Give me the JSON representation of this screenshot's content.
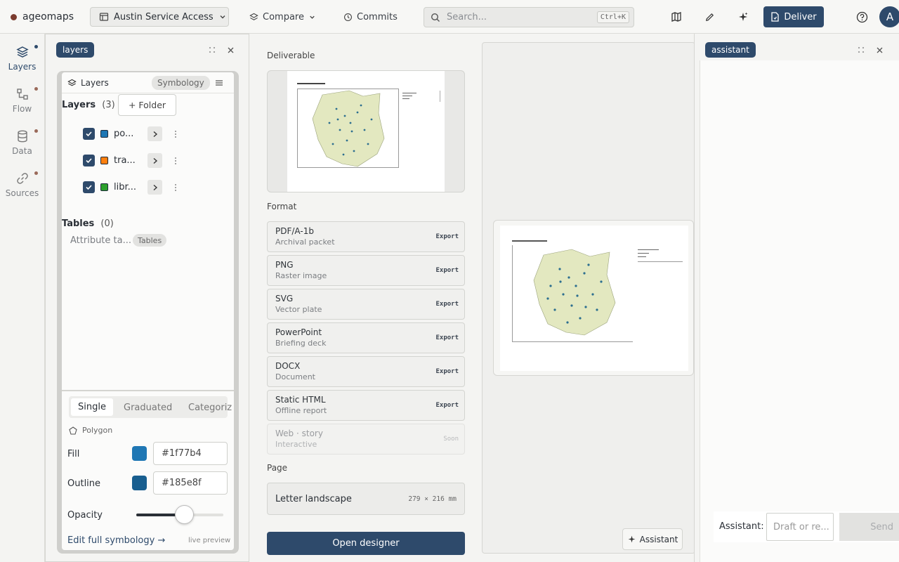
{
  "app": {
    "name": "ageomaps"
  },
  "topbar": {
    "project": "Austin Service Access",
    "compare": "Compare",
    "commits": "Commits",
    "search_placeholder": "Search...",
    "search_shortcut": "Ctrl+K",
    "deliver": "Deliver",
    "avatar": "A"
  },
  "rail": {
    "items": [
      {
        "label": "Layers",
        "icon": "layers-icon"
      },
      {
        "label": "Flow",
        "icon": "flow-icon"
      },
      {
        "label": "Data",
        "icon": "database-icon"
      },
      {
        "label": "Sources",
        "icon": "link-icon"
      }
    ]
  },
  "layers_panel": {
    "tab": "layers",
    "header_title": "Layers",
    "symbology_tab": "Symbology",
    "layers_heading": "Layers",
    "layers_count": "(3)",
    "folder_button": "+ Folder",
    "layers": [
      {
        "name": "po...",
        "color": "#1f77b4",
        "checked": true
      },
      {
        "name": "tra...",
        "color": "#ff7f0e",
        "checked": true
      },
      {
        "name": "libr...",
        "color": "#2ca02c",
        "checked": true
      }
    ],
    "tables_heading": "Tables",
    "tables_count": "(0)",
    "attribute_table": "Attribute ta...",
    "tables_badge": "Tables",
    "symbology": {
      "modes": [
        "Single",
        "Graduated",
        "Categorize"
      ],
      "active_mode": "Single",
      "geometry": "Polygon",
      "fill_label": "Fill",
      "fill_value": "#1f77b4",
      "outline_label": "Outline",
      "outline_value": "#185e8f",
      "opacity_label": "Opacity",
      "opacity": 0.55,
      "edit_link": "Edit full symbology →",
      "live_preview": "live preview"
    }
  },
  "deliver": {
    "deliverable_label": "Deliverable",
    "format_label": "Format",
    "formats": [
      {
        "name": "PDF/A-1b",
        "desc": "Archival packet",
        "action": "Export",
        "enabled": true
      },
      {
        "name": "PNG",
        "desc": "Raster image",
        "action": "Export",
        "enabled": true
      },
      {
        "name": "SVG",
        "desc": "Vector plate",
        "action": "Export",
        "enabled": true
      },
      {
        "name": "PowerPoint",
        "desc": "Briefing deck",
        "action": "Export",
        "enabled": true
      },
      {
        "name": "DOCX",
        "desc": "Document",
        "action": "Export",
        "enabled": true
      },
      {
        "name": "Static HTML",
        "desc": "Offline report",
        "action": "Export",
        "enabled": true
      },
      {
        "name": "Web · story",
        "desc": "Interactive",
        "action": "Soon",
        "enabled": false
      }
    ],
    "page_label": "Page",
    "page_size": "Letter landscape",
    "page_dims": "279 × 216 mm",
    "open_designer": "Open designer"
  },
  "preview": {
    "assistant_button": "Assistant"
  },
  "assistant_panel": {
    "tab": "assistant",
    "input_label": "Assistant:",
    "input_placeholder": "Draft or re...",
    "send": "Send"
  },
  "colors": {
    "accent": "#2e4a6b",
    "map_fill": "#e3e8c0",
    "point": "#2c6e8f"
  }
}
